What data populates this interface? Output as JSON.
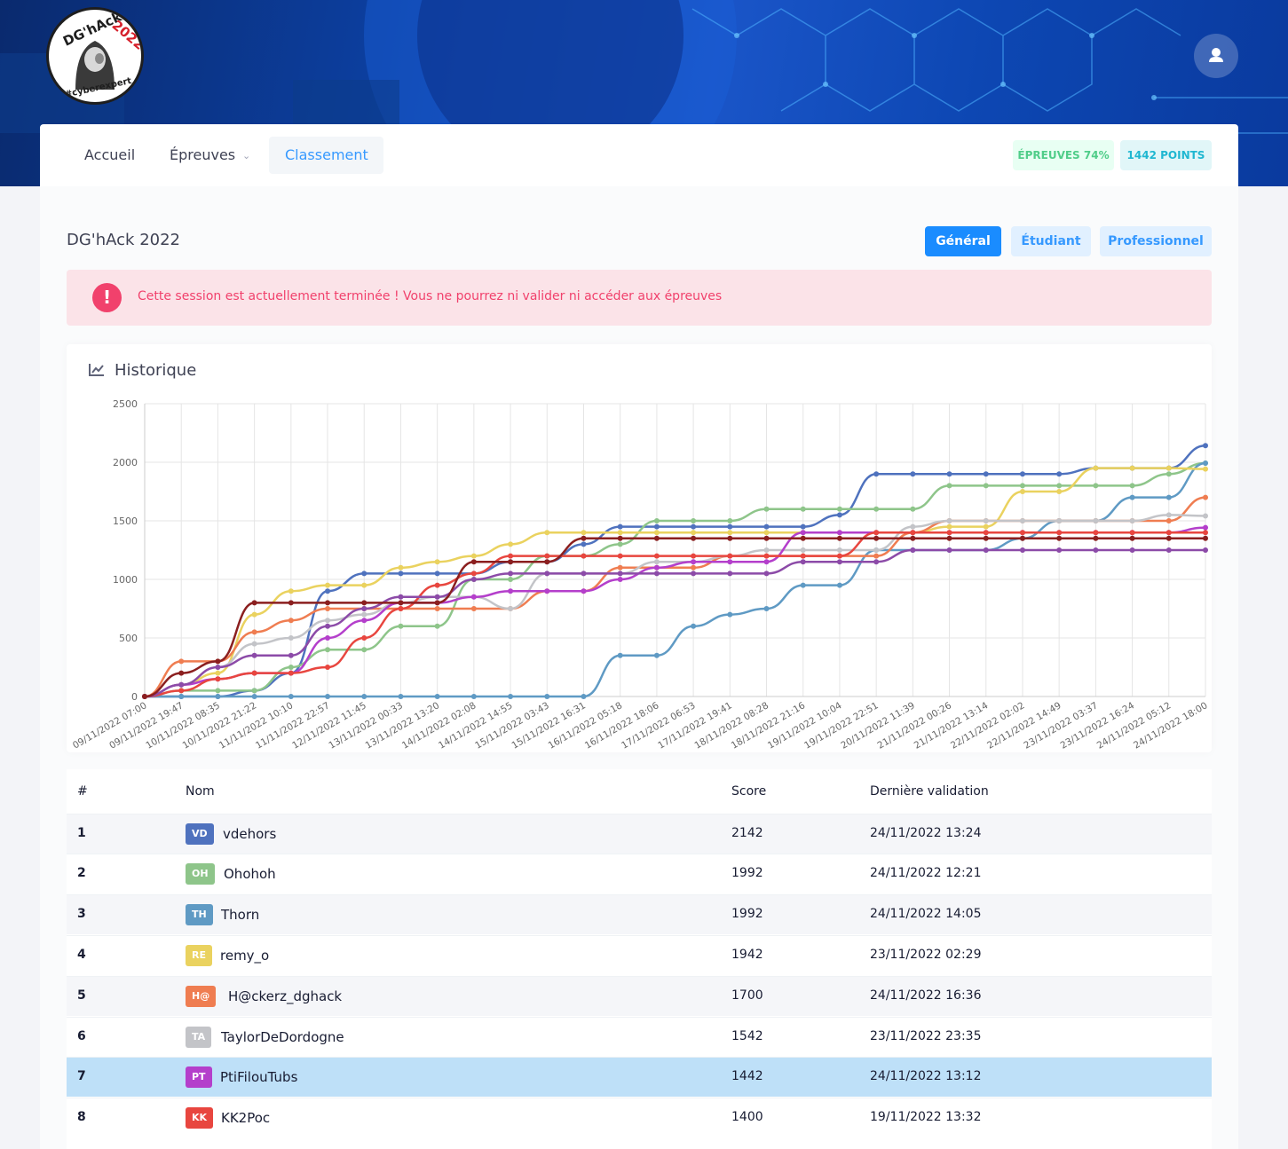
{
  "header": {
    "logo": {
      "text_top": "DG'hAck",
      "text_year": "2022",
      "text_bottom": "#cyberexpert"
    },
    "user_icon": "user-icon"
  },
  "nav": {
    "items": [
      {
        "label": "Accueil"
      },
      {
        "label": "Épreuves"
      },
      {
        "label": "Classement"
      }
    ],
    "progress_badge": "ÉPREUVES 74%",
    "points_badge": "1442 POINTS"
  },
  "page": {
    "title": "DG'hAck 2022",
    "tabs": [
      {
        "label": "Général"
      },
      {
        "label": "Étudiant"
      },
      {
        "label": "Professionnel"
      }
    ],
    "alert": "Cette session est actuellement terminée ! Vous ne pourrez ni valider ni accéder aux épreuves",
    "alert_icon": "exclamation-icon"
  },
  "history": {
    "title": "Historique",
    "icon": "line-chart-icon"
  },
  "chart_data": {
    "type": "line",
    "title": "",
    "ylim": [
      0,
      2500
    ],
    "yticks": [
      0,
      500,
      1000,
      1500,
      2000,
      2500
    ],
    "x": [
      "09/11/2022 07:00",
      "09/11/2022 19:47",
      "10/11/2022 08:35",
      "10/11/2022 21:22",
      "11/11/2022 10:10",
      "11/11/2022 22:57",
      "12/11/2022 11:45",
      "13/11/2022 00:33",
      "13/11/2022 13:20",
      "14/11/2022 02:08",
      "14/11/2022 14:55",
      "15/11/2022 03:43",
      "15/11/2022 16:31",
      "16/11/2022 05:18",
      "16/11/2022 18:06",
      "17/11/2022 06:53",
      "17/11/2022 19:41",
      "18/11/2022 08:28",
      "18/11/2022 21:16",
      "19/11/2022 10:04",
      "19/11/2022 22:51",
      "20/11/2022 11:39",
      "21/11/2022 00:26",
      "21/11/2022 13:14",
      "22/11/2022 02:02",
      "22/11/2022 14:49",
      "23/11/2022 03:37",
      "23/11/2022 16:24",
      "24/11/2022 05:12",
      "24/11/2022 18:00"
    ],
    "series": [
      {
        "name": "vdehors",
        "color": "#4f72be",
        "values": [
          0,
          0,
          0,
          50,
          200,
          900,
          1050,
          1050,
          1050,
          1050,
          1150,
          1150,
          1300,
          1450,
          1450,
          1450,
          1450,
          1450,
          1450,
          1550,
          1900,
          1900,
          1900,
          1900,
          1900,
          1900,
          1950,
          1950,
          1950,
          2142
        ]
      },
      {
        "name": "Ohohoh",
        "color": "#8ec58a",
        "values": [
          0,
          50,
          50,
          50,
          250,
          400,
          400,
          600,
          600,
          1000,
          1000,
          1200,
          1200,
          1300,
          1500,
          1500,
          1500,
          1600,
          1600,
          1600,
          1600,
          1600,
          1800,
          1800,
          1800,
          1800,
          1800,
          1800,
          1900,
          1992
        ]
      },
      {
        "name": "Thorn",
        "color": "#5f9ac4",
        "values": [
          0,
          0,
          0,
          0,
          0,
          0,
          0,
          0,
          0,
          0,
          0,
          0,
          0,
          350,
          350,
          600,
          700,
          750,
          950,
          950,
          1250,
          1250,
          1250,
          1250,
          1350,
          1500,
          1500,
          1700,
          1700,
          1992
        ]
      },
      {
        "name": "remy_o",
        "color": "#ead25f",
        "values": [
          0,
          100,
          200,
          700,
          900,
          950,
          950,
          1100,
          1150,
          1200,
          1300,
          1400,
          1400,
          1400,
          1400,
          1400,
          1400,
          1400,
          1400,
          1400,
          1400,
          1400,
          1450,
          1450,
          1750,
          1750,
          1950,
          1950,
          1950,
          1942
        ]
      },
      {
        "name": "H@ckerz_dghack",
        "color": "#ef7d51",
        "values": [
          0,
          300,
          300,
          550,
          650,
          750,
          750,
          750,
          750,
          750,
          750,
          900,
          900,
          1100,
          1100,
          1100,
          1200,
          1200,
          1200,
          1200,
          1200,
          1400,
          1500,
          1500,
          1500,
          1500,
          1500,
          1500,
          1500,
          1700
        ]
      },
      {
        "name": "TaylorDeDordogne",
        "color": "#c3c4c8",
        "values": [
          0,
          100,
          250,
          450,
          500,
          650,
          700,
          800,
          850,
          850,
          750,
          1050,
          1050,
          1050,
          1150,
          1150,
          1200,
          1250,
          1250,
          1250,
          1250,
          1450,
          1500,
          1500,
          1500,
          1500,
          1500,
          1500,
          1550,
          1542
        ]
      },
      {
        "name": "PtiFilouTubs",
        "color": "#b43fcb",
        "values": [
          0,
          100,
          150,
          200,
          200,
          500,
          650,
          800,
          800,
          850,
          900,
          900,
          900,
          1000,
          1100,
          1150,
          1150,
          1150,
          1400,
          1400,
          1400,
          1400,
          1400,
          1400,
          1400,
          1400,
          1400,
          1400,
          1400,
          1442
        ]
      },
      {
        "name": "KK2Poc",
        "color": "#e8463f",
        "values": [
          0,
          50,
          150,
          200,
          200,
          250,
          500,
          750,
          950,
          1050,
          1200,
          1200,
          1200,
          1200,
          1200,
          1200,
          1200,
          1200,
          1200,
          1200,
          1400,
          1400,
          1400,
          1400,
          1400,
          1400,
          1400,
          1400,
          1400,
          1400
        ]
      },
      {
        "name": "",
        "color": "#8c4ba8",
        "values": [
          0,
          100,
          250,
          350,
          350,
          600,
          750,
          850,
          850,
          1000,
          1050,
          1050,
          1050,
          1050,
          1050,
          1050,
          1050,
          1050,
          1150,
          1150,
          1150,
          1250,
          1250,
          1250,
          1250,
          1250,
          1250,
          1250,
          1250,
          1250
        ]
      },
      {
        "name": "",
        "color": "#8b1f1f",
        "values": [
          0,
          200,
          300,
          800,
          800,
          800,
          800,
          800,
          800,
          1150,
          1150,
          1150,
          1350,
          1350,
          1350,
          1350,
          1350,
          1350,
          1350,
          1350,
          1350,
          1350,
          1350,
          1350,
          1350,
          1350,
          1350,
          1350,
          1350,
          1350
        ]
      }
    ]
  },
  "table": {
    "headers": {
      "rank": "#",
      "name": "Nom",
      "score": "Score",
      "last": "Dernière validation"
    },
    "rows": [
      {
        "rank": "1",
        "initials": "VD",
        "color": "#4f72be",
        "name": "vdehors",
        "score": "2142",
        "last": "24/11/2022 13:24"
      },
      {
        "rank": "2",
        "initials": "OH",
        "color": "#8ec58a",
        "name": "Ohohoh",
        "score": "1992",
        "last": "24/11/2022 12:21"
      },
      {
        "rank": "3",
        "initials": "TH",
        "color": "#5f9ac4",
        "name": "Thorn",
        "score": "1992",
        "last": "24/11/2022 14:05"
      },
      {
        "rank": "4",
        "initials": "RE",
        "color": "#ead25f",
        "name": "remy_o",
        "score": "1942",
        "last": "23/11/2022 02:29"
      },
      {
        "rank": "5",
        "initials": "H@",
        "color": "#ef7d51",
        "name": "H@ckerz_dghack",
        "score": "1700",
        "last": "24/11/2022 16:36"
      },
      {
        "rank": "6",
        "initials": "TA",
        "color": "#c3c4c8",
        "name": "TaylorDeDordogne",
        "score": "1542",
        "last": "23/11/2022 23:35"
      },
      {
        "rank": "7",
        "initials": "PT",
        "color": "#b43fcb",
        "name": "PtiFilouTubs",
        "score": "1442",
        "last": "24/11/2022 13:12"
      },
      {
        "rank": "8",
        "initials": "KK",
        "color": "#e8463f",
        "name": "KK2Poc",
        "score": "1400",
        "last": "19/11/2022 13:32"
      }
    ]
  }
}
